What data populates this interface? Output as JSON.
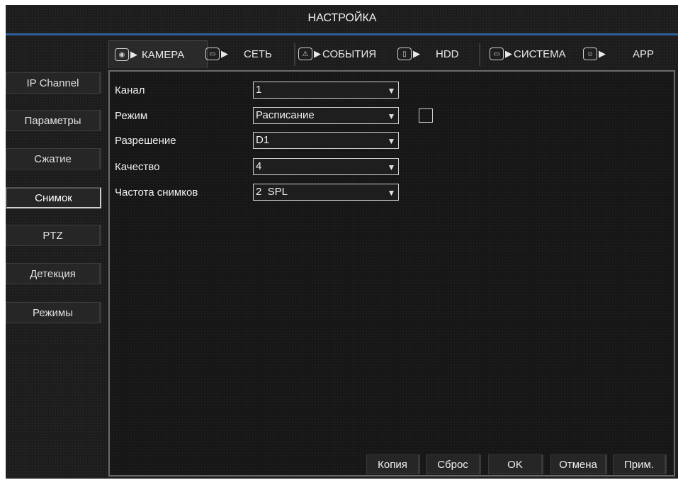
{
  "window": {
    "title": "НАСТРОЙКА"
  },
  "tabs": [
    {
      "label": "КАМЕРА",
      "icon": "camera-icon"
    },
    {
      "label": "СЕТЬ",
      "icon": "network-icon"
    },
    {
      "label": "СОБЫТИЯ",
      "icon": "alarm-icon"
    },
    {
      "label": "HDD",
      "icon": "storage-icon"
    },
    {
      "label": "СИСТЕМА",
      "icon": "monitor-icon"
    },
    {
      "label": "APP",
      "icon": "app-icon"
    }
  ],
  "sidebar": {
    "items": [
      {
        "label": "IP Channel"
      },
      {
        "label": "Параметры"
      },
      {
        "label": "Сжатие"
      },
      {
        "label": "Снимок"
      },
      {
        "label": "PTZ"
      },
      {
        "label": "Детекция"
      },
      {
        "label": "Режимы"
      }
    ]
  },
  "form": {
    "channel": {
      "label": "Канал",
      "value": "1"
    },
    "mode": {
      "label": "Режим",
      "value": "Расписание",
      "checkbox_checked": false
    },
    "resolution": {
      "label": "Разрешение",
      "value": "D1"
    },
    "quality": {
      "label": "Качество",
      "value": "4"
    },
    "snapshot_rate": {
      "label": "Частота снимков",
      "value": "2  SPL"
    }
  },
  "buttons": {
    "copy": "Копия",
    "reset": "Сброс",
    "ok": "OK",
    "cancel": "Отмена",
    "apply": "Прим."
  },
  "colors": {
    "accent_line": "#2f5f9a",
    "background": "#1c1c1c"
  }
}
